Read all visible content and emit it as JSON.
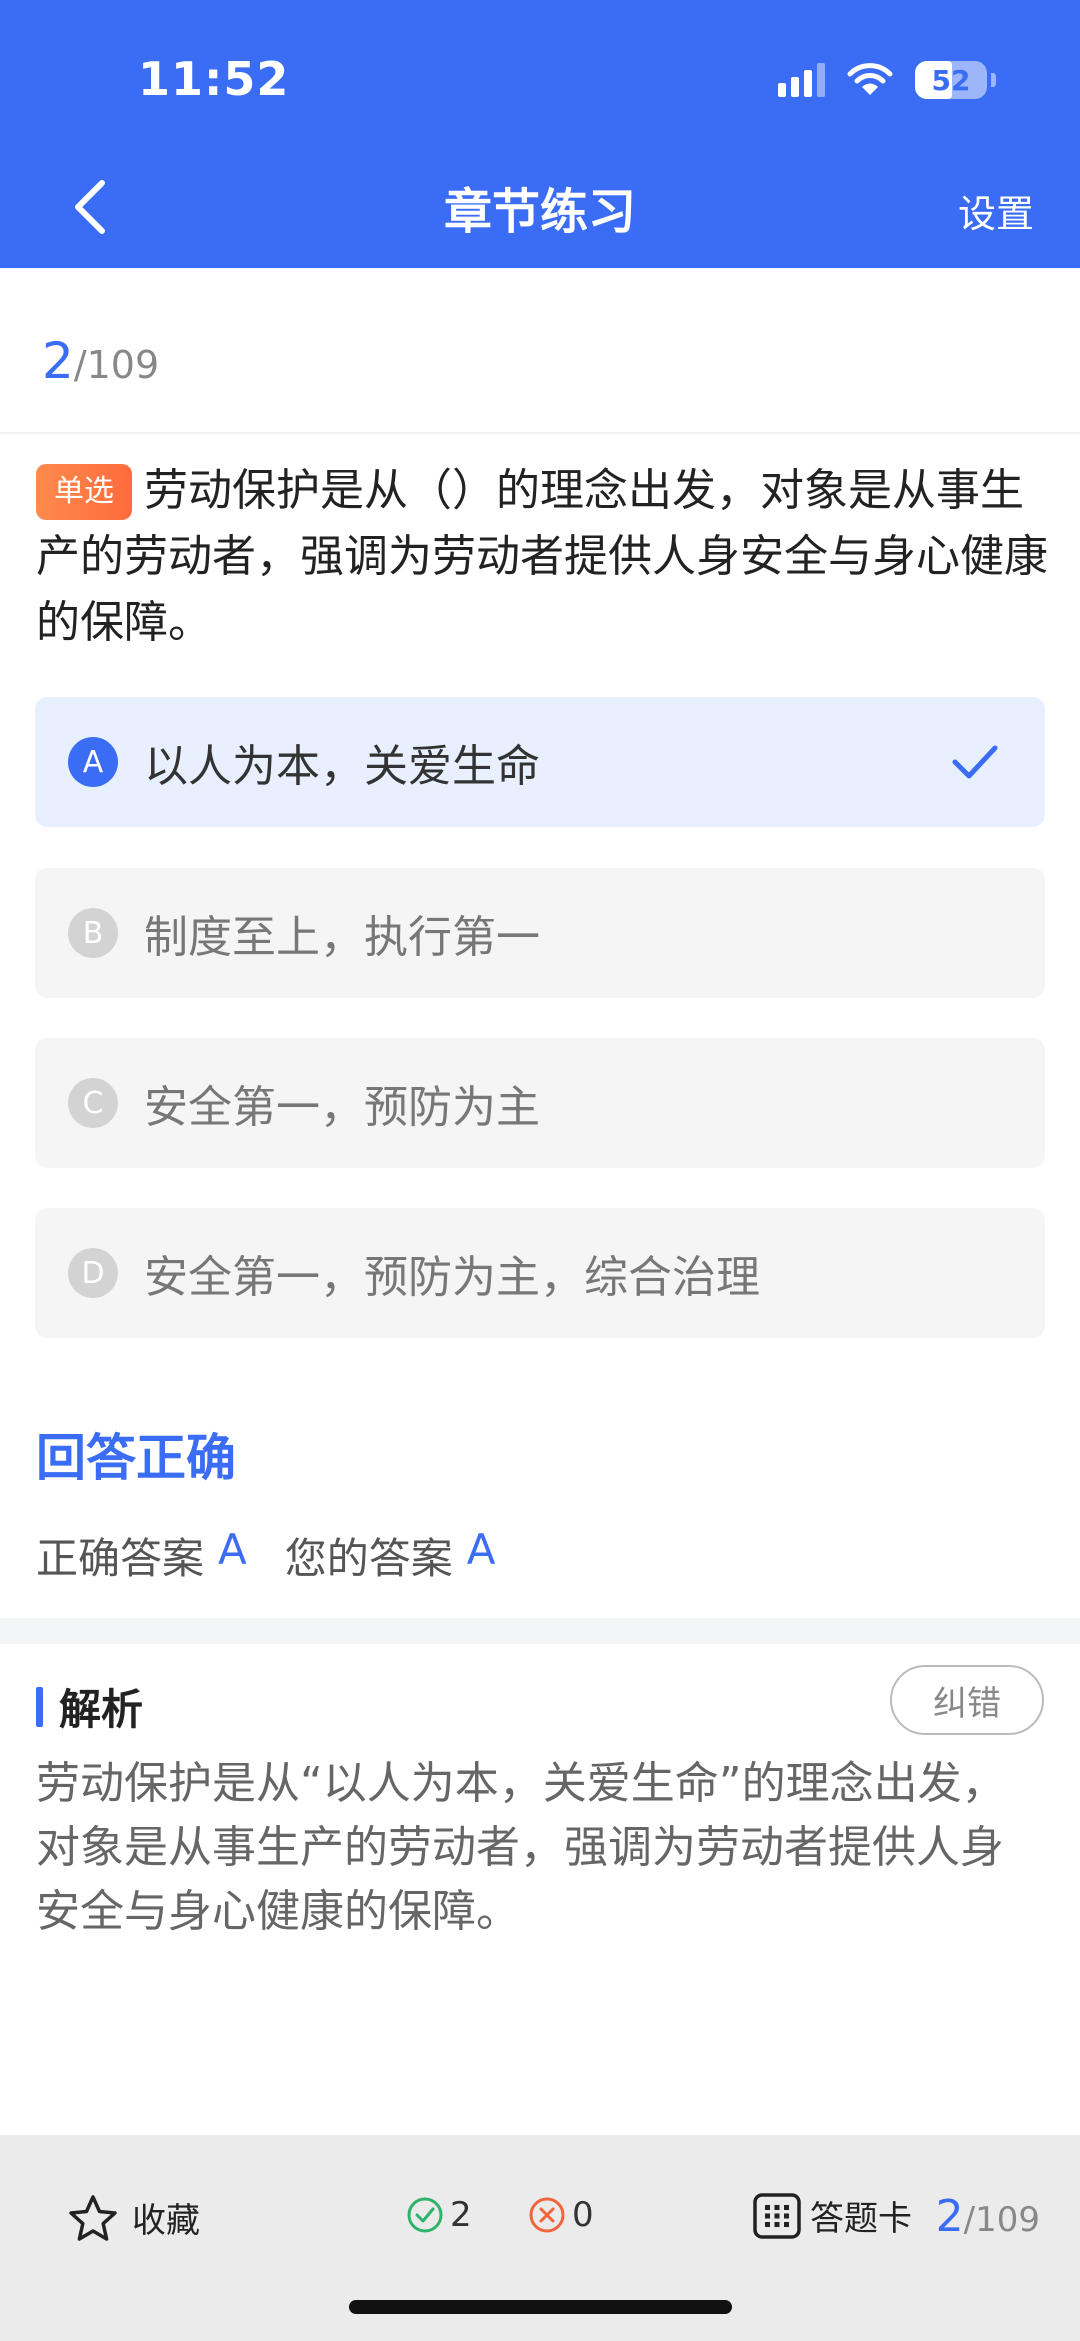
{
  "status_bar": {
    "time": "11:52",
    "battery": "52",
    "battery_level_percent": 52
  },
  "nav": {
    "title": "章节练习",
    "settings_label": "设置"
  },
  "progress": {
    "current": "2",
    "total": "/109"
  },
  "question": {
    "type_badge": "单选",
    "text": "劳动保护是从（）的理念出发，对象是从事生产的劳动者，强调为劳动者提供人身安全与身心健康的保障。"
  },
  "options": [
    {
      "letter": "A",
      "text": "以人为本，关爱生命",
      "selected": true
    },
    {
      "letter": "B",
      "text": "制度至上，执行第一",
      "selected": false
    },
    {
      "letter": "C",
      "text": "安全第一，预防为主",
      "selected": false
    },
    {
      "letter": "D",
      "text": "安全第一，预防为主，综合治理",
      "selected": false
    }
  ],
  "result": {
    "title": "回答正确",
    "correct_label": "正确答案",
    "correct_value": "A",
    "yours_label": "您的答案",
    "yours_value": "A"
  },
  "analysis": {
    "title": "解析",
    "report_label": "纠错",
    "body": "劳动保护是从“以人为本，关爱生命”的理念出发，对象是从事生产的劳动者，强调为劳动者提供人身安全与身心健康的保障。"
  },
  "bottom": {
    "favorite_label": "收藏",
    "correct_count": "2",
    "wrong_count": "0",
    "card_label": "答题卡",
    "progress_current": "2",
    "progress_total": "/109"
  },
  "colors": {
    "accent": "#3a6cf4",
    "badge": "#ff7a45",
    "correct": "#2fb36a",
    "wrong": "#f2643c"
  }
}
